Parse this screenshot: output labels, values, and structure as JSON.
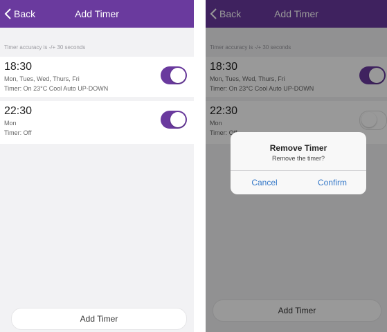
{
  "left": {
    "nav": {
      "back_label": "Back",
      "title": "Add Timer"
    },
    "hint": "Timer accuracy is -/+ 30 seconds",
    "timers": [
      {
        "time": "18:30",
        "days": "Mon, Tues, Wed, Thurs, Fri",
        "detail": "Timer: On   23°C   Cool   Auto   UP-DOWN",
        "enabled": true
      },
      {
        "time": "22:30",
        "days": "Mon",
        "detail": "Timer: Off",
        "enabled": true
      }
    ],
    "add_button": "Add Timer"
  },
  "right": {
    "nav": {
      "back_label": "Back",
      "title": "Add Timer"
    },
    "hint": "Timer accuracy is -/+ 30 seconds",
    "timers": [
      {
        "time": "18:30",
        "days": "Mon, Tues, Wed, Thurs, Fri",
        "detail": "Timer: On   23°C   Cool   Auto   UP-DOWN",
        "enabled": true
      },
      {
        "time": "22:30",
        "days": "Mon",
        "detail": "Timer: Off",
        "enabled": false
      }
    ],
    "add_button": "Add Timer",
    "dialog": {
      "title": "Remove Timer",
      "message": "Remove the timer?",
      "cancel": "Cancel",
      "confirm": "Confirm"
    }
  },
  "colors": {
    "accent": "#6a3a9e",
    "link": "#3478c8"
  }
}
